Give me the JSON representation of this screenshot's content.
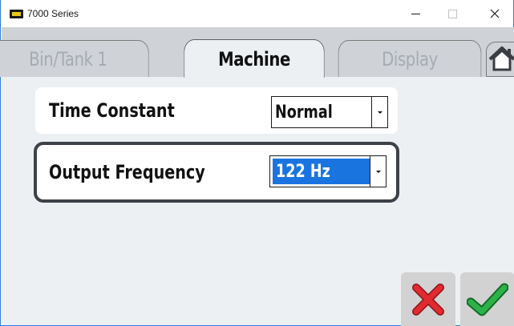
{
  "window": {
    "title": "7000 Series",
    "controls": {
      "minimize": "—",
      "maximize": "☐",
      "close": "✕"
    }
  },
  "tabs": [
    {
      "label": "Bin/Tank 1",
      "active": false
    },
    {
      "label": "Machine",
      "active": true
    },
    {
      "label": "Display",
      "active": false
    }
  ],
  "home": {
    "icon": "home-icon"
  },
  "settings": {
    "time_constant": {
      "label": "Time Constant",
      "value": "Normal"
    },
    "output_frequency": {
      "label": "Output Frequency",
      "value": "122 Hz"
    }
  },
  "actions": {
    "cancel_icon": "red-x-icon",
    "ok_icon": "green-check-icon"
  },
  "colors": {
    "tab_strip": "#cfd3d8",
    "content_bg": "#ecf0f3",
    "selection": "#1a74e0",
    "cancel": "#d7282e",
    "ok": "#22a53d"
  }
}
